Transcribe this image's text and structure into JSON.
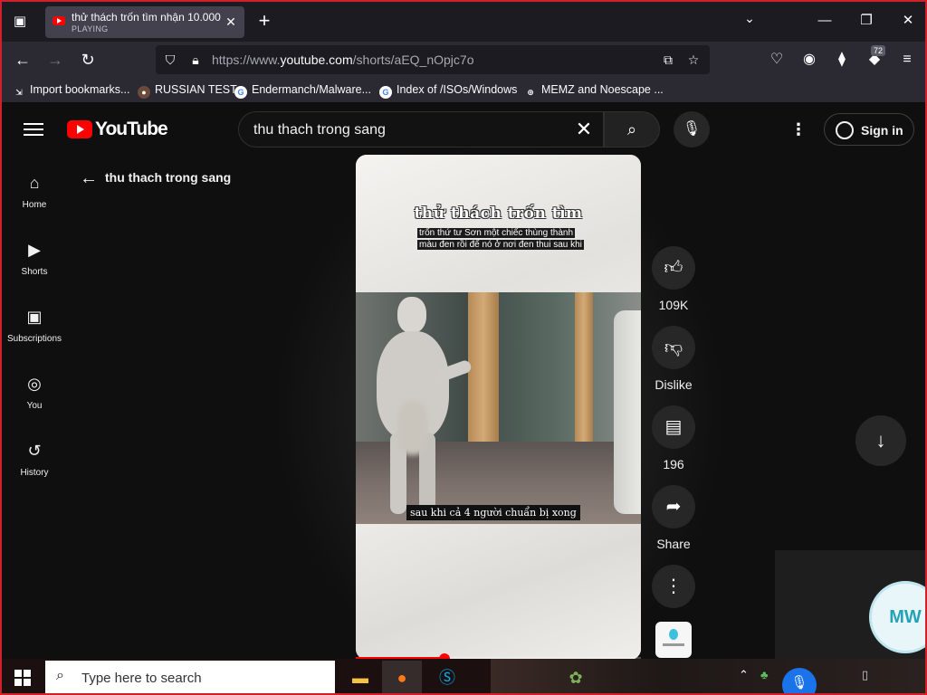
{
  "browser": {
    "tab": {
      "title": "thử thách trốn tìm nhận 10.000",
      "status": "PLAYING"
    },
    "url": {
      "prefix": "https://www.",
      "domain": "youtube.com",
      "path": "/shorts/aEQ_nOpjc7o"
    },
    "extension_badge": "72",
    "bookmarks": [
      {
        "label": "Import bookmarks...",
        "icon": "import-icon"
      },
      {
        "label": "RUSSIAN TEST",
        "icon": "avatar-icon"
      },
      {
        "label": "Endermanch/Malware...",
        "icon": "google-icon"
      },
      {
        "label": "Index of /ISOs/Windows",
        "icon": "google-icon"
      },
      {
        "label": "MEMZ and Noescape ...",
        "icon": "globe-icon"
      }
    ]
  },
  "youtube": {
    "logo_text": "YouTube",
    "search": {
      "value": "thu thach trong sang"
    },
    "sign_in": "Sign in",
    "sidebar": [
      {
        "label": "Home",
        "icon": "home-icon"
      },
      {
        "label": "Shorts",
        "icon": "shorts-icon"
      },
      {
        "label": "Subscriptions",
        "icon": "subscriptions-icon"
      },
      {
        "label": "You",
        "icon": "you-icon"
      },
      {
        "label": "History",
        "icon": "history-icon"
      }
    ],
    "back_label": "thu thach trong sang",
    "video": {
      "title": "thử thách trốn tìm",
      "caption_line1": "trốn thứ tư Sơn một chiếc thùng thành",
      "caption_line2": "màu đen rồi để nó ở nơi đen thui sau khi",
      "subtitle": "sau khi cả 4 người chuẩn bị xong",
      "progress": 0.31
    },
    "actions": {
      "likes": "109K",
      "dislike": "Dislike",
      "comments": "196",
      "share": "Share"
    },
    "overlay_avatar": "MW"
  },
  "taskbar": {
    "search_placeholder": "Type here to search"
  }
}
